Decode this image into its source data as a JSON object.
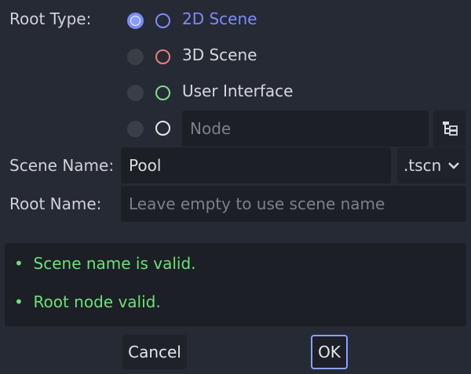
{
  "root_type": {
    "label": "Root Type:",
    "options": [
      {
        "label": "2D Scene",
        "selected": true,
        "color": "#7b8cff"
      },
      {
        "label": "3D Scene",
        "selected": false,
        "color": "#f07c7c"
      },
      {
        "label": "User Interface",
        "selected": false,
        "color": "#7fe08a"
      },
      {
        "label": "",
        "placeholder": "Node",
        "selected": false,
        "color": "#e8e8e8"
      }
    ]
  },
  "scene_name": {
    "label": "Scene Name:",
    "value": "Pool",
    "extension": ".tscn"
  },
  "root_name": {
    "label": "Root Name:",
    "placeholder": "Leave empty to use scene name",
    "value": ""
  },
  "messages": [
    "Scene name is valid.",
    "Root node valid."
  ],
  "buttons": {
    "cancel": "Cancel",
    "ok": "OK"
  },
  "colors": {
    "valid": "#6fe07a",
    "accent": "#8aa0ff",
    "background": "#262a34",
    "field": "#1c1f25"
  }
}
